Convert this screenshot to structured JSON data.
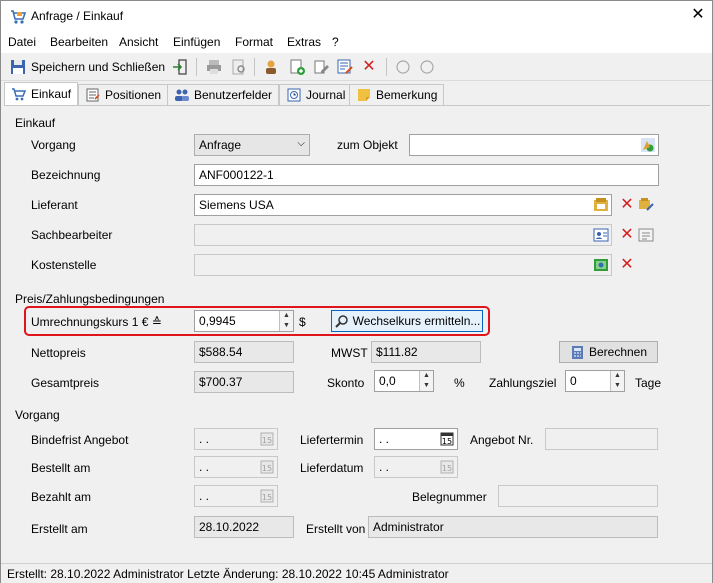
{
  "window": {
    "title": "Anfrage / Einkauf",
    "close_glyph": "✕"
  },
  "menu": [
    {
      "label": "Datei"
    },
    {
      "label": "Bearbeiten"
    },
    {
      "label": "Ansicht"
    },
    {
      "label": "Einfügen"
    },
    {
      "label": "Format"
    },
    {
      "label": "Extras"
    },
    {
      "label": "?"
    }
  ],
  "toolbar": {
    "save_close_label": "Speichern und Schließen"
  },
  "tabs": [
    {
      "label": "Einkauf",
      "active": true
    },
    {
      "label": "Positionen"
    },
    {
      "label": "Benutzerfelder"
    },
    {
      "label": "Journal"
    },
    {
      "label": "Bemerkung"
    }
  ],
  "einkauf": {
    "section_title": "Einkauf",
    "vorgang_label": "Vorgang",
    "vorgang_value": "Anfrage",
    "zum_objekt_label": "zum Objekt",
    "zum_objekt_value": "",
    "bezeichnung_label": "Bezeichnung",
    "bezeichnung_value": "ANF000122-1",
    "lieferant_label": "Lieferant",
    "lieferant_value": "Siemens USA",
    "sachbearbeiter_label": "Sachbearbeiter",
    "sachbearbeiter_value": "",
    "kostenstelle_label": "Kostenstelle",
    "kostenstelle_value": ""
  },
  "preis": {
    "section_title": "Preis/Zahlungsbedingungen",
    "umrechnung_label": "Umrechnungskurs 1 € ≙",
    "umrechnung_value": "0,9945",
    "currency": "$",
    "wechselkurs_button": "Wechselkurs ermitteln...",
    "nettopreis_label": "Nettopreis",
    "nettopreis_value": "$588.54",
    "mwst_label": "MWST",
    "mwst_value": "$111.82",
    "berechnen_button": "Berechnen",
    "gesamtpreis_label": "Gesamtpreis",
    "gesamtpreis_value": "$700.37",
    "skonto_label": "Skonto",
    "skonto_value": "0,0",
    "percent": "%",
    "zahlungsziel_label": "Zahlungsziel",
    "zahlungsziel_value": "0",
    "tage_label": "Tage"
  },
  "vorgang": {
    "section_title": "Vorgang",
    "bindefrist_label": "Bindefrist Angebot",
    "bindefrist_value": " .  .",
    "liefertermin_label": "Liefertermin",
    "liefertermin_value": " .  .",
    "angebot_nr_label": "Angebot Nr.",
    "angebot_nr_value": "",
    "bestellt_label": "Bestellt am",
    "bestellt_value": " .  .",
    "lieferdatum_label": "Lieferdatum",
    "lieferdatum_value": " .  .",
    "bezahlt_label": "Bezahlt am",
    "bezahlt_value": " .  .",
    "belegnummer_label": "Belegnummer",
    "belegnummer_value": "",
    "erstellt_am_label": "Erstellt am",
    "erstellt_am_value": "28.10.2022",
    "erstellt_von_label": "Erstellt von",
    "erstellt_von_value": "Administrator"
  },
  "status": {
    "text": "Erstellt: 28.10.2022 Administrator  Letzte Änderung: 28.10.2022 10:45 Administrator"
  },
  "colors": {
    "highlight_border": "#e0151b",
    "button_focus_border": "#0a64c8",
    "delete_red": "#d12020"
  }
}
